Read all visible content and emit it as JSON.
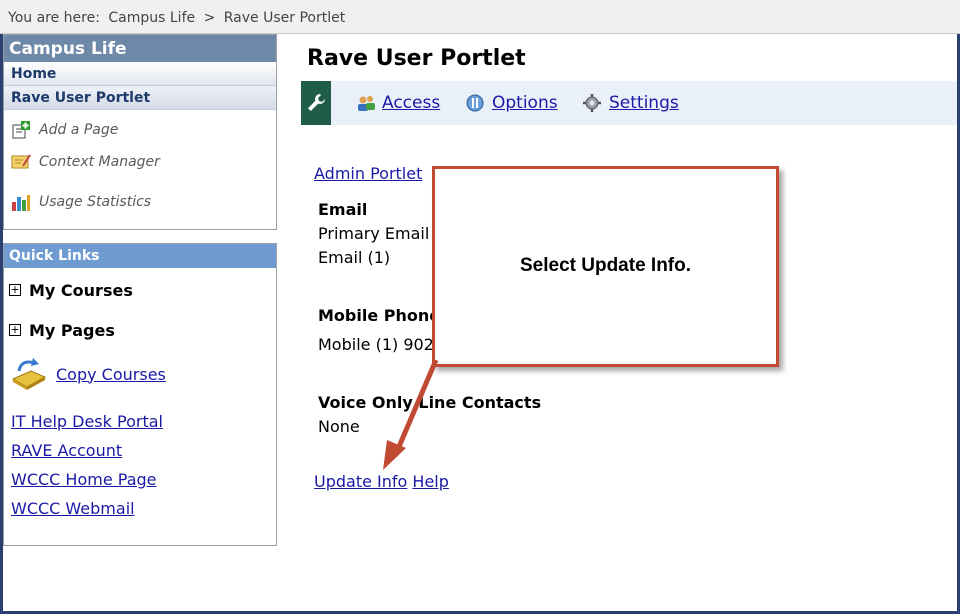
{
  "breadcrumb": {
    "prefix": "You are here:",
    "items": [
      "Campus Life",
      ">",
      "Rave User Portlet"
    ]
  },
  "left_panel": {
    "title": "Campus Life",
    "nav": [
      "Home",
      "Rave User Portlet"
    ],
    "tools": [
      "Add a Page",
      "Context Manager",
      "Usage Statistics"
    ]
  },
  "quick_links": {
    "title": "Quick Links",
    "expanders": [
      "My Courses",
      "My Pages"
    ],
    "copy_courses": "Copy Courses",
    "links": [
      "IT Help Desk Portal",
      "RAVE Account",
      "WCCC Home Page",
      "WCCC Webmail"
    ]
  },
  "main": {
    "title": "Rave User Portlet",
    "toolbar": [
      "Access",
      "Options",
      "Settings"
    ],
    "admin_link": "Admin Portlet",
    "email_heading": "Email",
    "primary_email": "Primary Email",
    "email_item": "Email (1)",
    "mobile_heading": "Mobile Phone",
    "mobile_item": "Mobile (1) 902",
    "voice_heading": "Voice Only Line Contacts",
    "voice_item": "None",
    "update_link": "Update Info",
    "help_link": "Help"
  },
  "callout": {
    "text": "Select Update Info."
  },
  "colors": {
    "header_blue": "#6e88a8",
    "quick_links_blue": "#6e9bd0",
    "link_blue": "#1a1aa6",
    "callout_red": "#c14a33",
    "wrench_green": "#1f5c4a"
  }
}
